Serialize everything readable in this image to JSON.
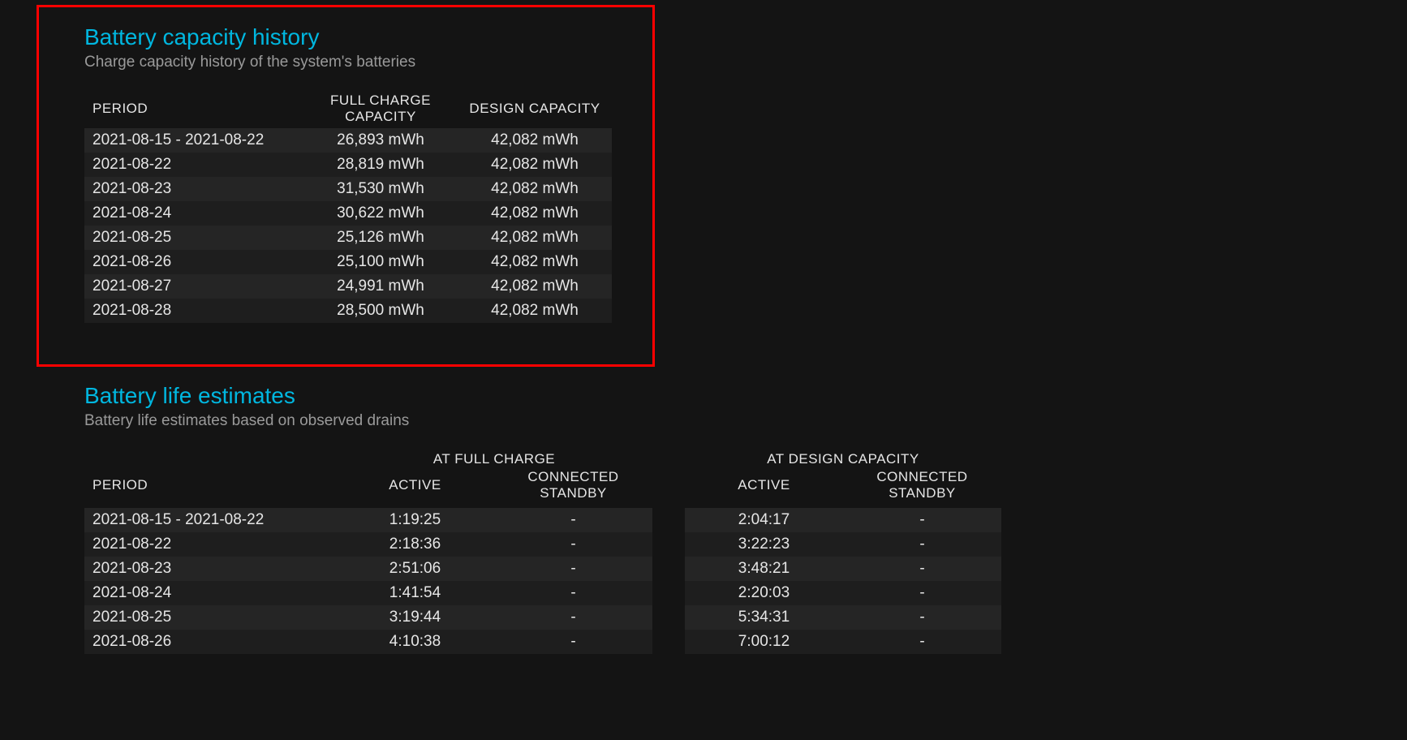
{
  "capacity": {
    "title": "Battery capacity history",
    "subtitle": "Charge capacity history of the system's batteries",
    "headers": {
      "period": "PERIOD",
      "full": "FULL CHARGE CAPACITY",
      "design": "DESIGN CAPACITY"
    },
    "rows": [
      {
        "period": "2021-08-15 - 2021-08-22",
        "full": "26,893 mWh",
        "design": "42,082 mWh"
      },
      {
        "period": "2021-08-22",
        "full": "28,819 mWh",
        "design": "42,082 mWh"
      },
      {
        "period": "2021-08-23",
        "full": "31,530 mWh",
        "design": "42,082 mWh"
      },
      {
        "period": "2021-08-24",
        "full": "30,622 mWh",
        "design": "42,082 mWh"
      },
      {
        "period": "2021-08-25",
        "full": "25,126 mWh",
        "design": "42,082 mWh"
      },
      {
        "period": "2021-08-26",
        "full": "25,100 mWh",
        "design": "42,082 mWh"
      },
      {
        "period": "2021-08-27",
        "full": "24,991 mWh",
        "design": "42,082 mWh"
      },
      {
        "period": "2021-08-28",
        "full": "28,500 mWh",
        "design": "42,082 mWh"
      }
    ]
  },
  "life": {
    "title": "Battery life estimates",
    "subtitle": "Battery life estimates based on observed drains",
    "headers": {
      "period": "PERIOD",
      "group_full": "AT FULL CHARGE",
      "group_design": "AT DESIGN CAPACITY",
      "active": "ACTIVE",
      "standby": "CONNECTED STANDBY"
    },
    "rows": [
      {
        "period": "2021-08-15 - 2021-08-22",
        "fc_active": "1:19:25",
        "fc_standby": "-",
        "dc_active": "2:04:17",
        "dc_standby": "-"
      },
      {
        "period": "2021-08-22",
        "fc_active": "2:18:36",
        "fc_standby": "-",
        "dc_active": "3:22:23",
        "dc_standby": "-"
      },
      {
        "period": "2021-08-23",
        "fc_active": "2:51:06",
        "fc_standby": "-",
        "dc_active": "3:48:21",
        "dc_standby": "-"
      },
      {
        "period": "2021-08-24",
        "fc_active": "1:41:54",
        "fc_standby": "-",
        "dc_active": "2:20:03",
        "dc_standby": "-"
      },
      {
        "period": "2021-08-25",
        "fc_active": "3:19:44",
        "fc_standby": "-",
        "dc_active": "5:34:31",
        "dc_standby": "-"
      },
      {
        "period": "2021-08-26",
        "fc_active": "4:10:38",
        "fc_standby": "-",
        "dc_active": "7:00:12",
        "dc_standby": "-"
      }
    ]
  }
}
